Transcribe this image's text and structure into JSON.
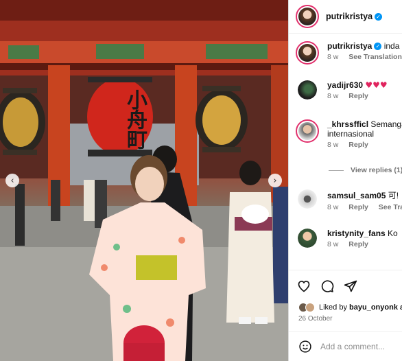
{
  "post": {
    "author": "putrikristya",
    "photo_description_icon": "photo-icon"
  },
  "header": {
    "username": "putrikristya",
    "verified_icon": "verified-badge-icon"
  },
  "caption": {
    "username": "putrikristya",
    "text": "inda",
    "time": "8 w",
    "see_translation": "See Translation"
  },
  "comments": [
    {
      "username": "yadijr630",
      "text": "",
      "hearts": "♥♥♥",
      "time": "8 w",
      "reply": "Reply"
    },
    {
      "username": "_khrssfficl",
      "text": "Semanga",
      "text2": "internasional",
      "time": "8 w",
      "reply": "Reply"
    },
    {
      "username": "samsul_sam05",
      "text": "可!",
      "time": "8 w",
      "reply": "Reply",
      "see_translation": "See Transla"
    },
    {
      "username": "kristynity_fans",
      "text": "Ko",
      "time": "8 w",
      "reply": "Reply"
    }
  ],
  "view_replies": "View replies (1)",
  "liked_by": {
    "prefix": "Liked by",
    "user": "bayu_onyonk",
    "suffix": "a"
  },
  "date": "26 October",
  "add_comment": {
    "placeholder": "Add a comment..."
  },
  "photo_text": {
    "lantern": "小舟町"
  },
  "colors": {
    "accent": "#0095f6",
    "heart": "#e0245e",
    "ring": "#e1306c"
  }
}
